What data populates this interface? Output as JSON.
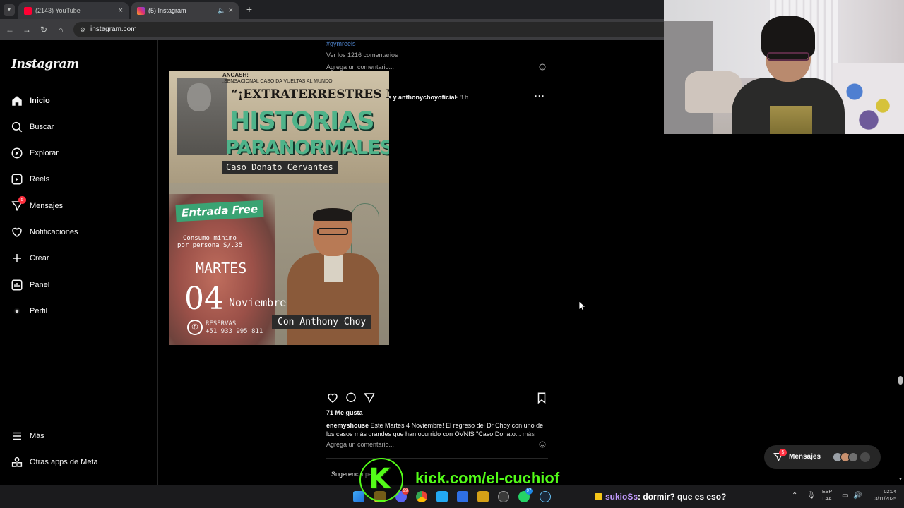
{
  "browser": {
    "tabs": [
      {
        "title": "(2143) YouTube",
        "active": false
      },
      {
        "title": "(5) Instagram",
        "active": true
      }
    ],
    "url": "instagram.com"
  },
  "sidebar": {
    "logo": "Instagram",
    "items": [
      {
        "label": "Inicio",
        "icon": "home-icon",
        "active": true
      },
      {
        "label": "Buscar",
        "icon": "search-icon"
      },
      {
        "label": "Explorar",
        "icon": "compass-icon"
      },
      {
        "label": "Reels",
        "icon": "reels-icon"
      },
      {
        "label": "Mensajes",
        "icon": "messenger-icon",
        "badge": "5"
      },
      {
        "label": "Notificaciones",
        "icon": "heart-icon"
      },
      {
        "label": "Crear",
        "icon": "plus-icon"
      },
      {
        "label": "Panel",
        "icon": "dashboard-icon"
      },
      {
        "label": "Perfil",
        "icon": "profile-icon"
      }
    ],
    "bottom": [
      {
        "label": "Más",
        "icon": "menu-icon"
      },
      {
        "label": "Otras apps de Meta",
        "icon": "meta-apps-icon"
      }
    ]
  },
  "previous_post": {
    "hashtag": "#gymreels",
    "view_comments": "Ver los 1216 comentarios",
    "add_comment": "Agrega un comentario..."
  },
  "post": {
    "authors": "enemyshouse y anthonychoyoficial",
    "time": "• 8 h",
    "poster": {
      "ancash": "ANCASH:",
      "ancash_sub": ":SENSACIONAL CASO DA VUELTAS AL MUNDO!",
      "headline": "“¡EXTRATERRESTRES ME CURARON EL BRAZO",
      "title_line1": "HISTORIAS",
      "title_line2": "PARANORMALES",
      "case_name": "Caso Donato Cervantes",
      "free_entry": "Entrada Free",
      "consumo_line1": "Consumo mínimo",
      "consumo_line2": "por persona S/.35",
      "weekday": "MARTES",
      "day": "04",
      "month": "Noviembre",
      "reservas": "RESERVAS",
      "phone": "+51 933 995 811",
      "host": "Con Anthony Choy"
    },
    "likes": "71 Me gusta",
    "caption_user": "enemyshouse",
    "caption_text": "Este Martes 4 Noviembre! El regreso del Dr Choy con uno de los casos más grandes que han ocurrido con OVNIS \"Caso Donato...",
    "caption_more": "más",
    "add_comment": "Agrega un comentario...",
    "suggestions": "Sugerencia pa"
  },
  "messages_pill": {
    "label": "Mensajes",
    "badge": "5"
  },
  "stream_overlay": {
    "kick_logo": "K",
    "kick_url": "kick.com/el-cuchiof",
    "chat_user": "sukioSs",
    "chat_text": ": dormir? que es eso?"
  },
  "taskbar": {
    "lang_line1": "ESP",
    "lang_line2": "LAA",
    "time": "02:04",
    "date": "3/11/2025",
    "badges": {
      "discord": "99",
      "whatsapp": "97"
    }
  },
  "colors": {
    "background": "#000000",
    "kick_green": "#53fc18",
    "badge_red": "#ff3040",
    "link_blue": "#4e82c9"
  }
}
